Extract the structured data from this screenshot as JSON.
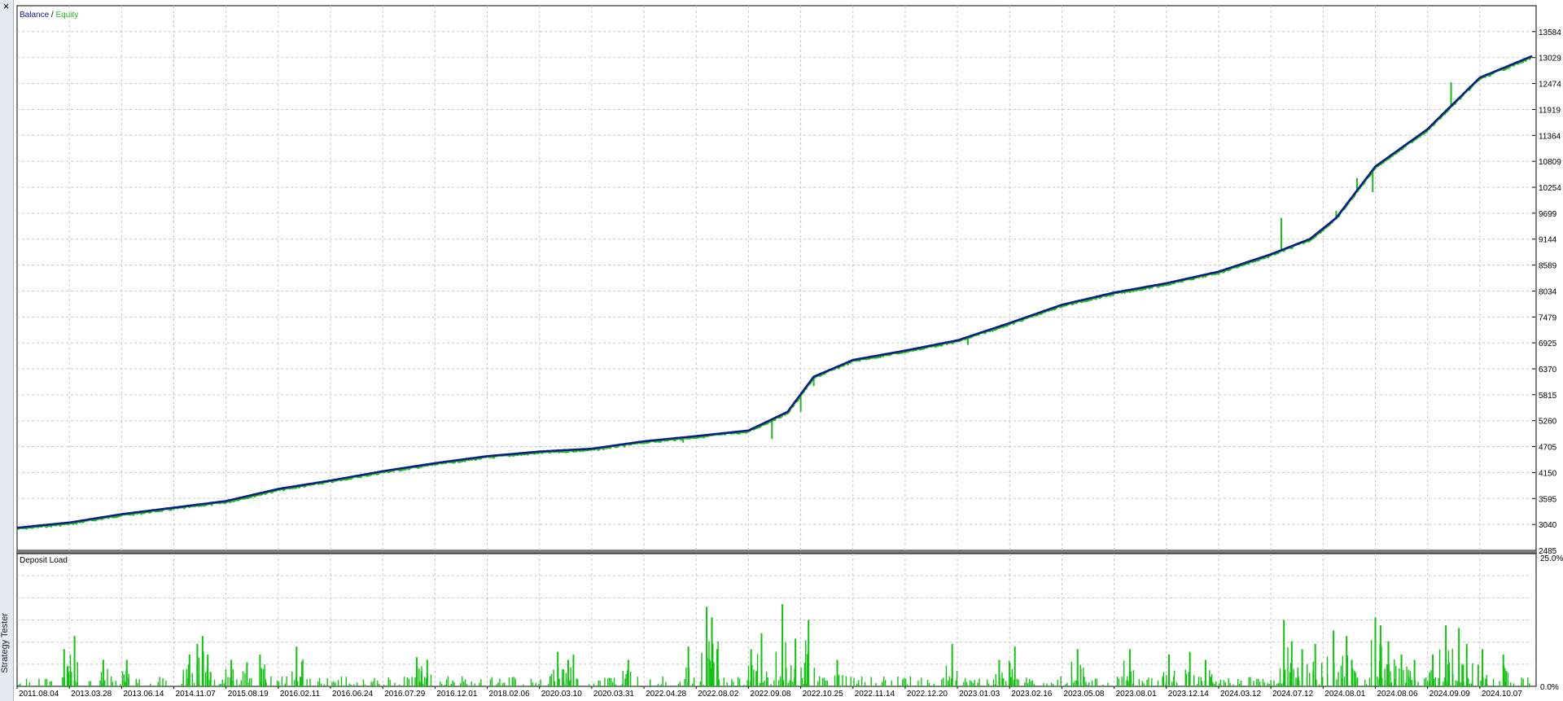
{
  "window": {
    "panel_label": "Strategy Tester",
    "close_glyph": "×"
  },
  "colors": {
    "balance": "#0a1a8c",
    "equity": "#1fb81f",
    "deposit_load": "#12c012",
    "grid": "#c8c8c8",
    "frame": "#000000",
    "separator": "#7a7a7a"
  },
  "chart_data": [
    {
      "type": "line",
      "legend": [
        {
          "name": "Balance",
          "color": "#0a1a8c"
        },
        {
          "name": "Equity",
          "color": "#1fb81f"
        }
      ],
      "legend_separator": " / ",
      "legend_position": "top-left",
      "ylim": [
        2485,
        14139
      ],
      "y_ticks": [
        13584,
        13029,
        12474,
        11919,
        11364,
        10809,
        10254,
        9699,
        9144,
        8589,
        8034,
        7479,
        6925,
        6370,
        5815,
        5260,
        4705,
        4150,
        3595,
        3040,
        2485
      ],
      "grid": true,
      "x_index_range": [
        0,
        58
      ],
      "series": [
        {
          "name": "Balance",
          "x": [
            0,
            2,
            4,
            6,
            8,
            10,
            12,
            14,
            16,
            18,
            20,
            22,
            24,
            26,
            28,
            29.5,
            30.5,
            32,
            34,
            36,
            38,
            40,
            42,
            44,
            46,
            48,
            49.5,
            50.5,
            52,
            54,
            56,
            58
          ],
          "y": [
            2970,
            3080,
            3260,
            3400,
            3540,
            3800,
            3980,
            4180,
            4350,
            4500,
            4600,
            4660,
            4820,
            4930,
            5050,
            5450,
            6200,
            6560,
            6760,
            6980,
            7350,
            7740,
            8000,
            8200,
            8450,
            8820,
            9150,
            9600,
            10700,
            11500,
            12600,
            13060
          ]
        }
      ],
      "equity_dips": [
        {
          "x": 28.9,
          "y": 4870
        },
        {
          "x": 30.0,
          "y": 5450
        },
        {
          "x": 30.5,
          "y": 6000
        },
        {
          "x": 43.7,
          "y": 8100
        },
        {
          "x": 48.4,
          "y": 9600
        },
        {
          "x": 50.5,
          "y": 9750
        },
        {
          "x": 51.3,
          "y": 10450
        },
        {
          "x": 51.9,
          "y": 10150
        },
        {
          "x": 54.9,
          "y": 12500
        },
        {
          "x": 55.6,
          "y": 12420
        },
        {
          "x": 13.0,
          "y": 4080
        },
        {
          "x": 21.0,
          "y": 4600
        },
        {
          "x": 36.4,
          "y": 6880
        },
        {
          "x": 25.5,
          "y": 4790
        }
      ]
    },
    {
      "type": "bar",
      "title": "Deposit Load",
      "unit": "%",
      "ylim": [
        0,
        25
      ],
      "y_tick_labels": [
        "25.0%",
        "0.0%"
      ],
      "x_tick_labels": [
        "2011.08.04",
        "2013.03.28",
        "2013.06.14",
        "2014.11.07",
        "2015.08.19",
        "2016.02.11",
        "2016.06.24",
        "2016.07.29",
        "2016.12.01",
        "2018.02.06",
        "2020.03.10",
        "2020.03.31",
        "2022.04.28",
        "2022.08.02",
        "2022.09.08",
        "2022.10.25",
        "2022.11.14",
        "2022.12.20",
        "2023.01.03",
        "2023.02.16",
        "2023.05.08",
        "2023.08.01",
        "2023.12.14",
        "2024.03.12",
        "2024.07.12",
        "2024.08.01",
        "2024.08.06",
        "2024.09.09",
        "2024.10.07"
      ],
      "spikes": [
        {
          "x": 1.8,
          "y": 7
        },
        {
          "x": 2.2,
          "y": 9.5
        },
        {
          "x": 3.3,
          "y": 5
        },
        {
          "x": 4.2,
          "y": 5
        },
        {
          "x": 6.6,
          "y": 6
        },
        {
          "x": 6.9,
          "y": 8
        },
        {
          "x": 7.1,
          "y": 9.5
        },
        {
          "x": 7.3,
          "y": 6
        },
        {
          "x": 8.2,
          "y": 5
        },
        {
          "x": 8.8,
          "y": 4.5
        },
        {
          "x": 9.3,
          "y": 6
        },
        {
          "x": 10.7,
          "y": 7.5
        },
        {
          "x": 15.3,
          "y": 5.5
        },
        {
          "x": 15.7,
          "y": 5
        },
        {
          "x": 20.7,
          "y": 6.5
        },
        {
          "x": 21.1,
          "y": 5
        },
        {
          "x": 21.3,
          "y": 6
        },
        {
          "x": 23.4,
          "y": 5
        },
        {
          "x": 25.7,
          "y": 7.5
        },
        {
          "x": 26.4,
          "y": 15
        },
        {
          "x": 26.6,
          "y": 13
        },
        {
          "x": 26.8,
          "y": 7
        },
        {
          "x": 28.1,
          "y": 7
        },
        {
          "x": 28.5,
          "y": 10
        },
        {
          "x": 29.3,
          "y": 15.5
        },
        {
          "x": 29.8,
          "y": 9
        },
        {
          "x": 30.3,
          "y": 12.5
        },
        {
          "x": 31.4,
          "y": 5
        },
        {
          "x": 35.8,
          "y": 8
        },
        {
          "x": 37.6,
          "y": 5
        },
        {
          "x": 38.2,
          "y": 7.5
        },
        {
          "x": 40.6,
          "y": 7
        },
        {
          "x": 42.6,
          "y": 7
        },
        {
          "x": 44.1,
          "y": 6
        },
        {
          "x": 44.9,
          "y": 6.5
        },
        {
          "x": 45.5,
          "y": 5
        },
        {
          "x": 48.5,
          "y": 12.5
        },
        {
          "x": 48.8,
          "y": 8.5
        },
        {
          "x": 49.2,
          "y": 7
        },
        {
          "x": 49.7,
          "y": 8
        },
        {
          "x": 50.4,
          "y": 10.5
        },
        {
          "x": 50.9,
          "y": 9.5
        },
        {
          "x": 51.1,
          "y": 5
        },
        {
          "x": 52.0,
          "y": 13
        },
        {
          "x": 52.2,
          "y": 11.5
        },
        {
          "x": 52.5,
          "y": 8.5
        },
        {
          "x": 53.0,
          "y": 6
        },
        {
          "x": 53.5,
          "y": 5
        },
        {
          "x": 54.2,
          "y": 6
        },
        {
          "x": 54.7,
          "y": 11.5
        },
        {
          "x": 55.2,
          "y": 11
        },
        {
          "x": 55.5,
          "y": 8
        },
        {
          "x": 56.1,
          "y": 7
        },
        {
          "x": 56.9,
          "y": 6
        }
      ]
    }
  ]
}
